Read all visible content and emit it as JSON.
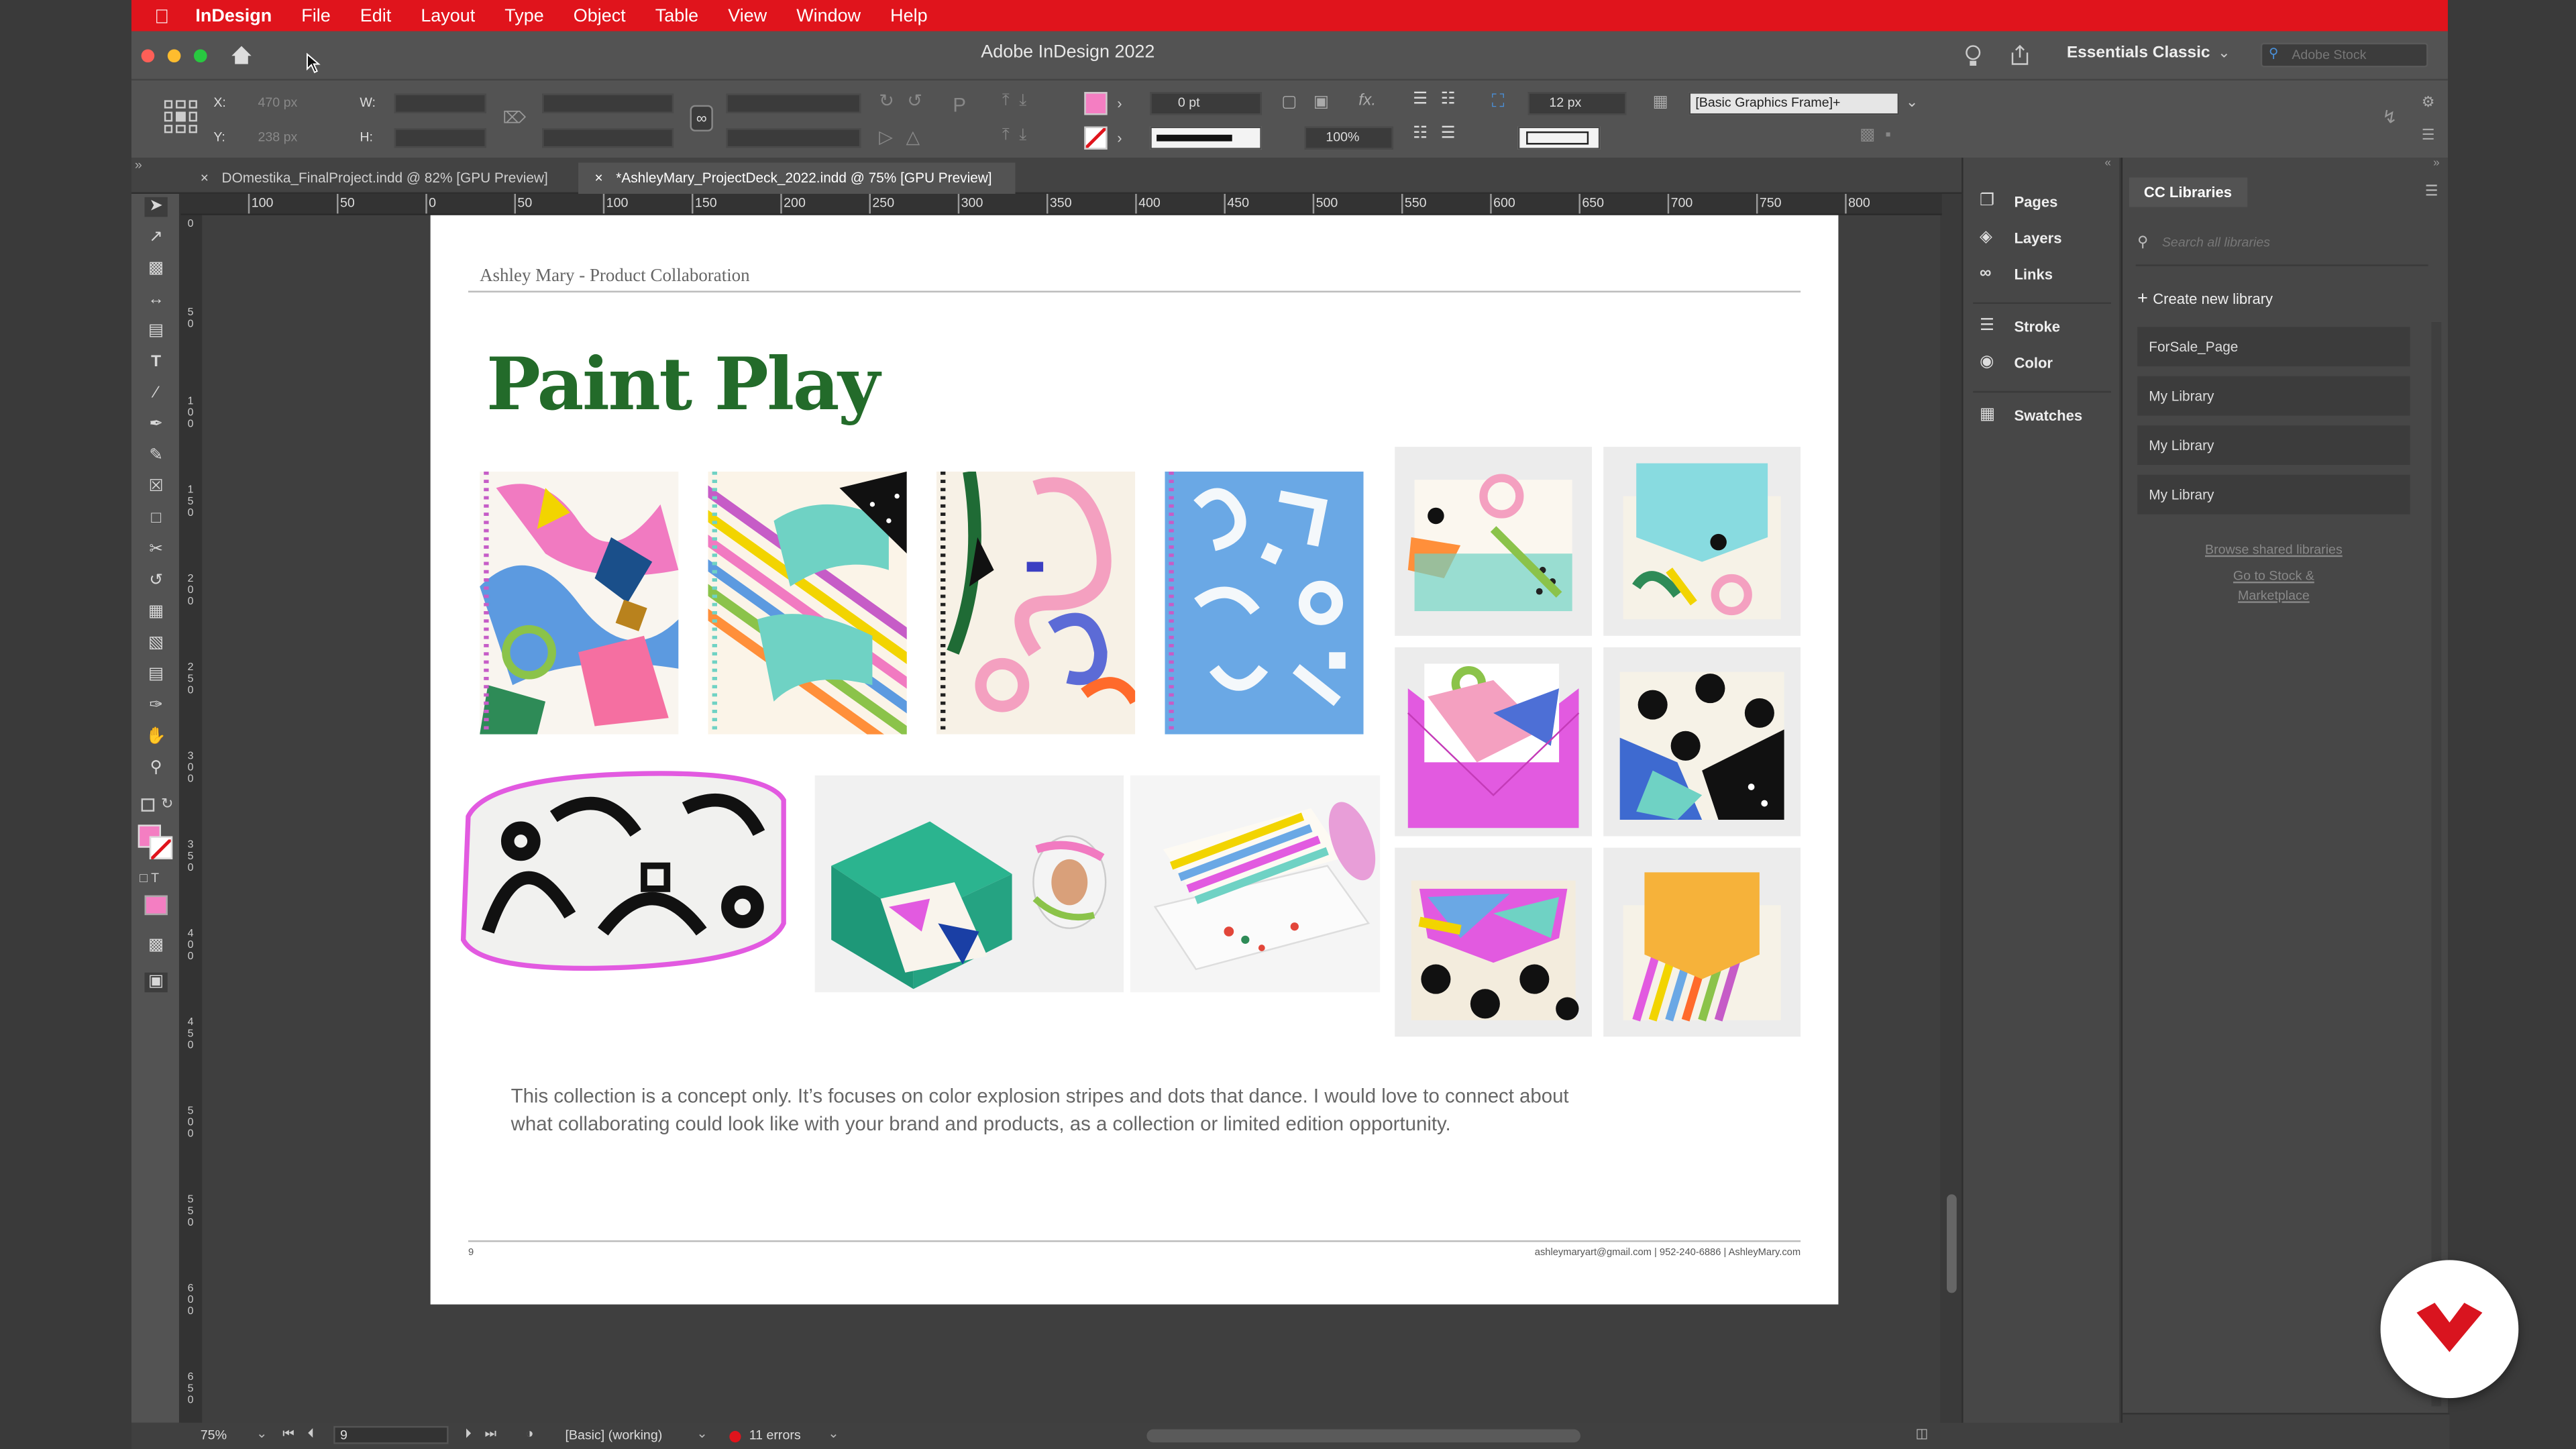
{
  "menubar": {
    "app_name": "InDesign",
    "items": [
      "File",
      "Edit",
      "Layout",
      "Type",
      "Object",
      "Table",
      "View",
      "Window",
      "Help"
    ]
  },
  "titlebar": {
    "title": "Adobe InDesign 2022",
    "workspace": "Essentials Classic",
    "stock_placeholder": "Adobe Stock"
  },
  "control": {
    "x_label": "X:",
    "x_value": "470 px",
    "y_label": "Y:",
    "y_value": "238 px",
    "w_label": "W:",
    "h_label": "H:",
    "stroke_weight": "0 pt",
    "opacity": "100%",
    "spacing": "12 px",
    "object_style": "[Basic Graphics Frame]+"
  },
  "tabs": [
    {
      "label": "DOmestika_FinalProject.indd @ 82% [GPU Preview]"
    },
    {
      "label": "*AshleyMary_ProjectDeck_2022.indd @ 75% [GPU Preview]"
    }
  ],
  "ruler": {
    "h_ticks": [
      "100",
      "50",
      "0",
      "50",
      "100",
      "150",
      "200",
      "250",
      "300",
      "350",
      "400",
      "450",
      "500",
      "550",
      "600",
      "650",
      "700",
      "750",
      "800"
    ],
    "v_ticks": [
      "0",
      "50",
      "100",
      "150",
      "200",
      "250",
      "300",
      "350",
      "400",
      "450",
      "500",
      "550",
      "600",
      "650"
    ]
  },
  "document": {
    "header": "Ashley Mary - Product Collaboration",
    "title": "Paint Play",
    "body_line1": "This collection is a concept only. It’s focuses on color explosion stripes and dots that dance.  I would love to connect about",
    "body_line2": "what collaborating could look like with your brand and products, as a collection or limited edition opportunity.",
    "page_number": "9",
    "footer_contact": "ashleymaryart@gmail.com | 952-240-6886 | AshleyMary.com",
    "title_color": "#236b2a"
  },
  "dock": {
    "items": [
      "Pages",
      "Layers",
      "Links",
      "Stroke",
      "Color",
      "Swatches"
    ]
  },
  "cc_libraries": {
    "title": "CC Libraries",
    "search_placeholder": "Search all libraries",
    "create_label": "Create new library",
    "libraries": [
      "ForSale_Page",
      "My Library",
      "My Library",
      "My Library"
    ],
    "browse_link": "Browse shared libraries",
    "stock_link_1": "Go to Stock &",
    "stock_link_2": "Marketplace"
  },
  "status": {
    "zoom": "75%",
    "page": "9",
    "preflight_profile": "[Basic] (working)",
    "errors": "11 errors"
  },
  "colors": {
    "menubar": "#e0141c",
    "fill_swatch": "#f47ec2",
    "brand_badge": "#d9141f"
  }
}
